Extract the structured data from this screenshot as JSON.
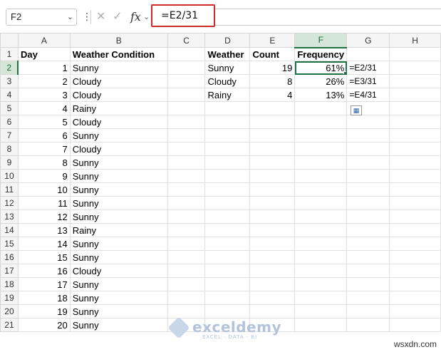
{
  "formula_bar": {
    "name_box": "F2",
    "fx_label": "fx",
    "formula": "=E2/31"
  },
  "columns": [
    "A",
    "B",
    "C",
    "D",
    "E",
    "F",
    "G",
    "H"
  ],
  "rows": [
    {
      "n": "1",
      "A": "Day",
      "B": "Weather Condition",
      "C": "",
      "D": "Weather",
      "E": "Count",
      "F": "Frequency",
      "G": ""
    },
    {
      "n": "2",
      "A": "1",
      "B": "Sunny",
      "C": "",
      "D": "Sunny",
      "E": "19",
      "F": "61%",
      "G": "=E2/31"
    },
    {
      "n": "3",
      "A": "2",
      "B": "Cloudy",
      "C": "",
      "D": "Cloudy",
      "E": "8",
      "F": "26%",
      "G": "=E3/31"
    },
    {
      "n": "4",
      "A": "3",
      "B": "Cloudy",
      "C": "",
      "D": "Rainy",
      "E": "4",
      "F": "13%",
      "G": "=E4/31"
    },
    {
      "n": "5",
      "A": "4",
      "B": "Rainy"
    },
    {
      "n": "6",
      "A": "5",
      "B": "Cloudy"
    },
    {
      "n": "7",
      "A": "6",
      "B": "Sunny"
    },
    {
      "n": "8",
      "A": "7",
      "B": "Cloudy"
    },
    {
      "n": "9",
      "A": "8",
      "B": "Sunny"
    },
    {
      "n": "10",
      "A": "9",
      "B": "Sunny"
    },
    {
      "n": "11",
      "A": "10",
      "B": "Sunny"
    },
    {
      "n": "12",
      "A": "11",
      "B": "Sunny"
    },
    {
      "n": "13",
      "A": "12",
      "B": "Sunny"
    },
    {
      "n": "14",
      "A": "13",
      "B": "Rainy"
    },
    {
      "n": "15",
      "A": "14",
      "B": "Sunny"
    },
    {
      "n": "16",
      "A": "15",
      "B": "Sunny"
    },
    {
      "n": "17",
      "A": "16",
      "B": "Cloudy"
    },
    {
      "n": "18",
      "A": "17",
      "B": "Sunny"
    },
    {
      "n": "19",
      "A": "18",
      "B": "Sunny"
    },
    {
      "n": "20",
      "A": "19",
      "B": "Sunny"
    },
    {
      "n": "21",
      "A": "20",
      "B": "Sunny"
    }
  ],
  "watermark": {
    "name": "exceldemy",
    "tagline": "EXCEL · DATA · BI"
  },
  "credit": "wsxdn.com",
  "colors": {
    "accent": "#1e7145",
    "highlight_box": "#d02b2b"
  },
  "icons": [
    "chevron-down-icon",
    "more-options-icon",
    "cancel-icon",
    "enter-icon",
    "fx-icon",
    "quick-analysis-icon"
  ]
}
